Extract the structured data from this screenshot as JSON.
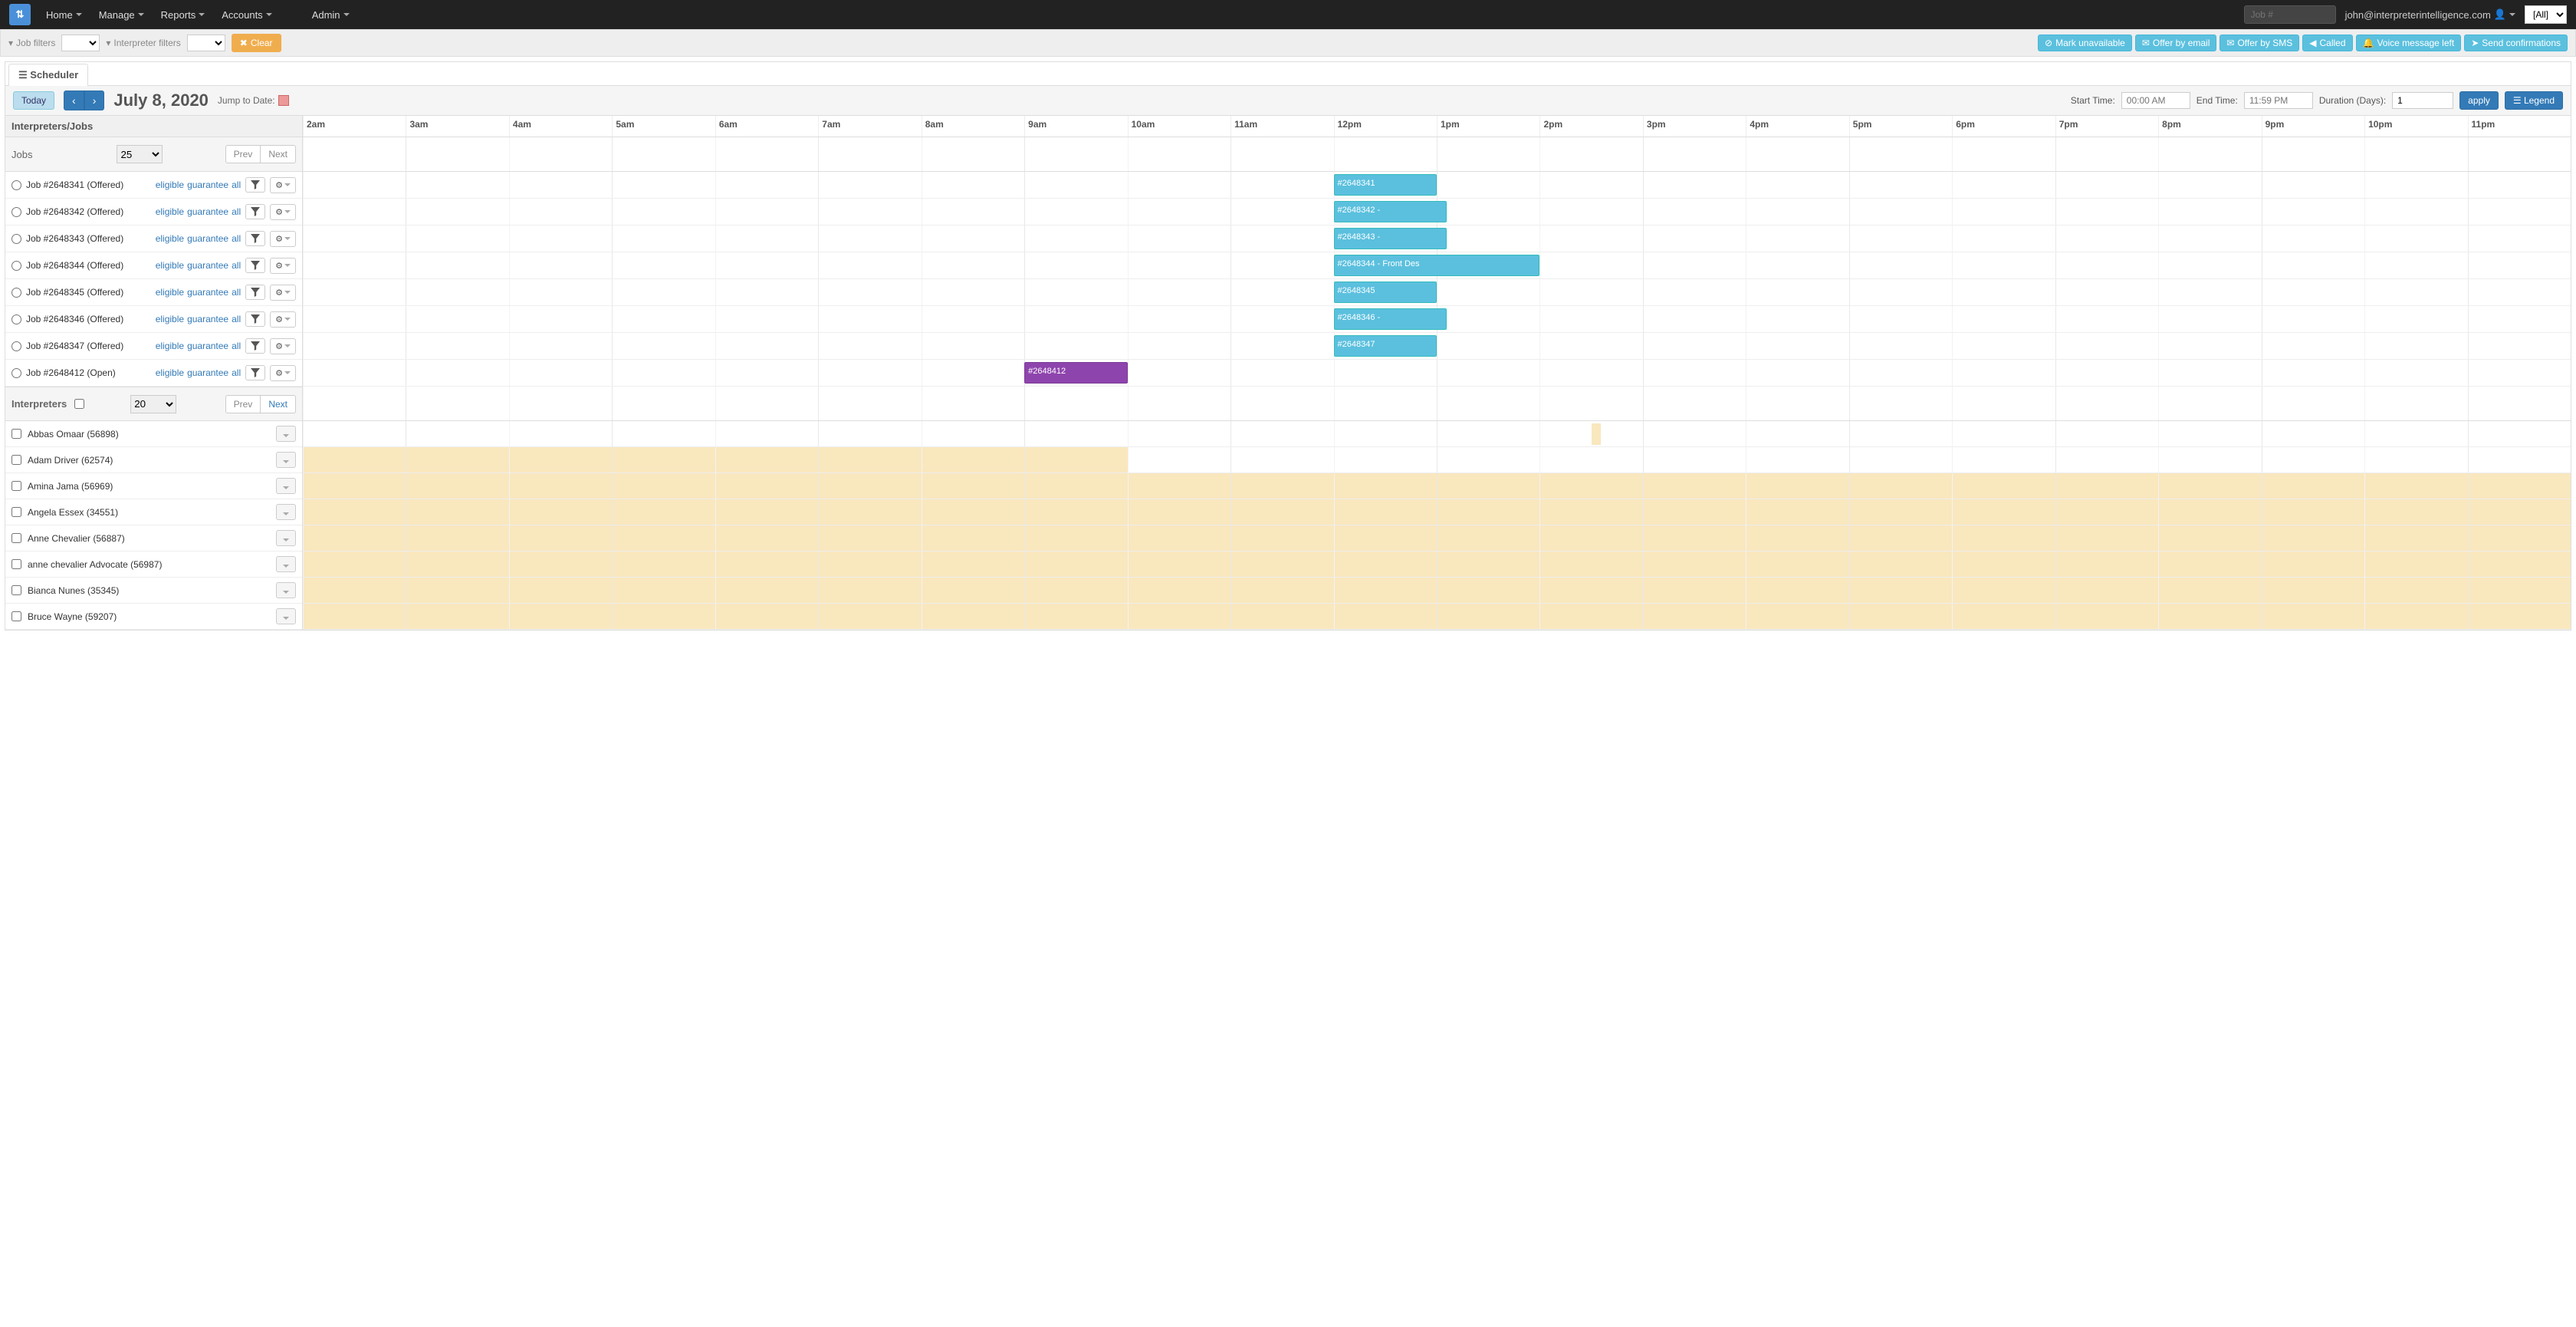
{
  "nav": {
    "items": [
      "Home",
      "Manage",
      "Reports",
      "Accounts",
      "Admin"
    ],
    "job_placeholder": "Job #",
    "user": "john@interpreterintelligence.com",
    "all": "[All]"
  },
  "filters": {
    "job_filters": "Job filters",
    "interpreter_filters": "Interpreter filters",
    "clear": "Clear",
    "actions": [
      "Mark unavailable",
      "Offer by email",
      "Offer by SMS",
      "Called",
      "Voice message left",
      "Send confirmations"
    ]
  },
  "tab": "Scheduler",
  "datebar": {
    "today": "Today",
    "title": "July 8, 2020",
    "jump": "Jump to Date:",
    "start_label": "Start Time:",
    "start_val": "00:00 AM",
    "end_label": "End Time:",
    "end_val": "11:59 PM",
    "dur_label": "Duration (Days):",
    "dur_val": "1",
    "apply": "apply",
    "legend": "Legend"
  },
  "left_header": "Interpreters/Jobs",
  "jobs_section": {
    "title": "Jobs",
    "size": "25",
    "prev": "Prev",
    "next": "Next"
  },
  "hours": [
    "2am",
    "3am",
    "4am",
    "5am",
    "6am",
    "7am",
    "8am",
    "9am",
    "10am",
    "11am",
    "12pm",
    "1pm",
    "2pm",
    "3pm",
    "4pm",
    "5pm",
    "6pm",
    "7pm",
    "8pm",
    "9pm",
    "10pm",
    "11pm"
  ],
  "job_links": {
    "eligible": "eligible",
    "guarantee": "guarantee",
    "all": "all"
  },
  "jobs": [
    {
      "label": "Job #2648341 (Offered)",
      "block": "#2648341",
      "start": 10,
      "width": 1,
      "type": "teal"
    },
    {
      "label": "Job #2648342 (Offered)",
      "block": "#2648342 -",
      "start": 10,
      "width": 1.1,
      "type": "teal"
    },
    {
      "label": "Job #2648343 (Offered)",
      "block": "#2648343 -",
      "start": 10,
      "width": 1.1,
      "type": "teal"
    },
    {
      "label": "Job #2648344 (Offered)",
      "block": "#2648344 - Front Des",
      "start": 10,
      "width": 2,
      "type": "teal"
    },
    {
      "label": "Job #2648345 (Offered)",
      "block": "#2648345",
      "start": 10,
      "width": 1,
      "type": "teal"
    },
    {
      "label": "Job #2648346 (Offered)",
      "block": "#2648346 -",
      "start": 10,
      "width": 1.1,
      "type": "teal"
    },
    {
      "label": "Job #2648347 (Offered)",
      "block": "#2648347",
      "start": 10,
      "width": 1,
      "type": "teal"
    },
    {
      "label": "Job #2648412 (Open)",
      "block": "#2648412",
      "start": 7,
      "width": 1,
      "type": "purple"
    }
  ],
  "int_section": {
    "title": "Interpreters",
    "size": "20",
    "prev": "Prev",
    "next": "Next"
  },
  "interpreters": [
    {
      "name": "Abbas Omaar (56898)",
      "unavail_start": -1,
      "unavail_end": -1,
      "block_at": 12.5
    },
    {
      "name": "Adam Driver (62574)",
      "unavail_start": 0,
      "unavail_end": 8
    },
    {
      "name": "Amina Jama (56969)",
      "unavail_start": 0,
      "unavail_end": 22
    },
    {
      "name": "Angela Essex (34551)",
      "unavail_start": 0,
      "unavail_end": 22
    },
    {
      "name": "Anne Chevalier (56887)",
      "unavail_start": 0,
      "unavail_end": 22
    },
    {
      "name": "anne chevalier Advocate (56987)",
      "unavail_start": 0,
      "unavail_end": 22
    },
    {
      "name": "Bianca Nunes (35345)",
      "unavail_start": 0,
      "unavail_end": 22
    },
    {
      "name": "Bruce Wayne (59207)",
      "unavail_start": 0,
      "unavail_end": 22
    }
  ]
}
